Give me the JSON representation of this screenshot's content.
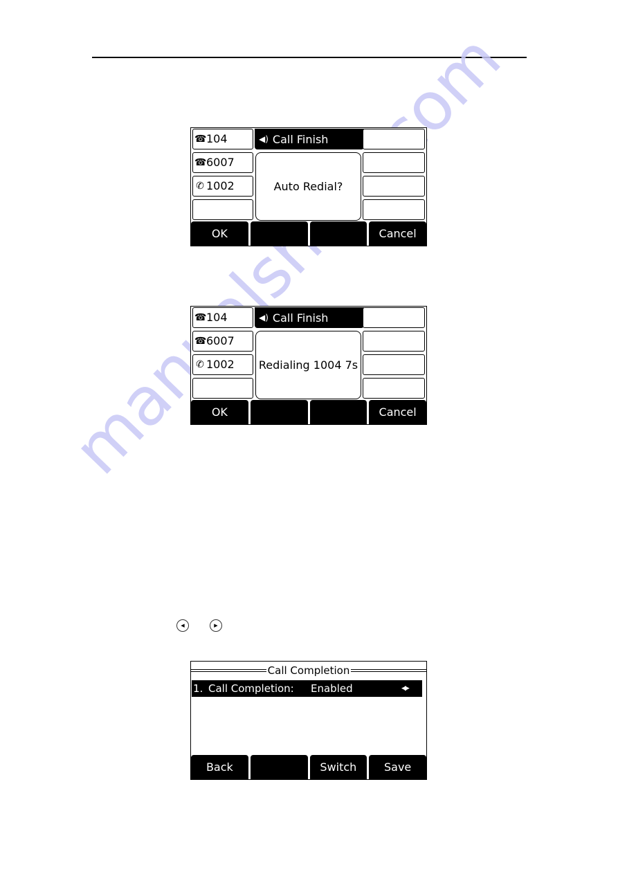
{
  "watermark": "manualshive.com",
  "screens": [
    {
      "title": "Call Finish",
      "title_icon": "speaker-icon",
      "line_keys": [
        {
          "icon": "desk-phone-icon",
          "glyph": "☎",
          "label": "104"
        },
        {
          "icon": "desk-phone-icon",
          "glyph": "☎",
          "label": "6007"
        },
        {
          "icon": "handset-icon",
          "glyph": "✆",
          "label": "1002"
        },
        {
          "icon": "",
          "glyph": "",
          "label": ""
        }
      ],
      "message": "Auto Redial?",
      "softkeys": [
        "OK",
        "",
        "",
        "Cancel"
      ]
    },
    {
      "title": "Call Finish",
      "title_icon": "speaker-icon",
      "line_keys": [
        {
          "icon": "desk-phone-icon",
          "glyph": "☎",
          "label": "104"
        },
        {
          "icon": "desk-phone-icon",
          "glyph": "☎",
          "label": "6007"
        },
        {
          "icon": "handset-icon",
          "glyph": "✆",
          "label": "1002"
        },
        {
          "icon": "",
          "glyph": "",
          "label": ""
        }
      ],
      "message": "Redialing 1004 7s",
      "softkeys": [
        "OK",
        "",
        "",
        "Cancel"
      ]
    }
  ],
  "nav_icons": {
    "left": "◀",
    "right": "▶"
  },
  "call_completion": {
    "title": "Call Completion",
    "row": {
      "index": "1.",
      "label": "Call Completion:",
      "value": "Enabled",
      "arrows": "◀▶"
    },
    "softkeys": [
      "Back",
      "",
      "Switch",
      "Save"
    ]
  }
}
